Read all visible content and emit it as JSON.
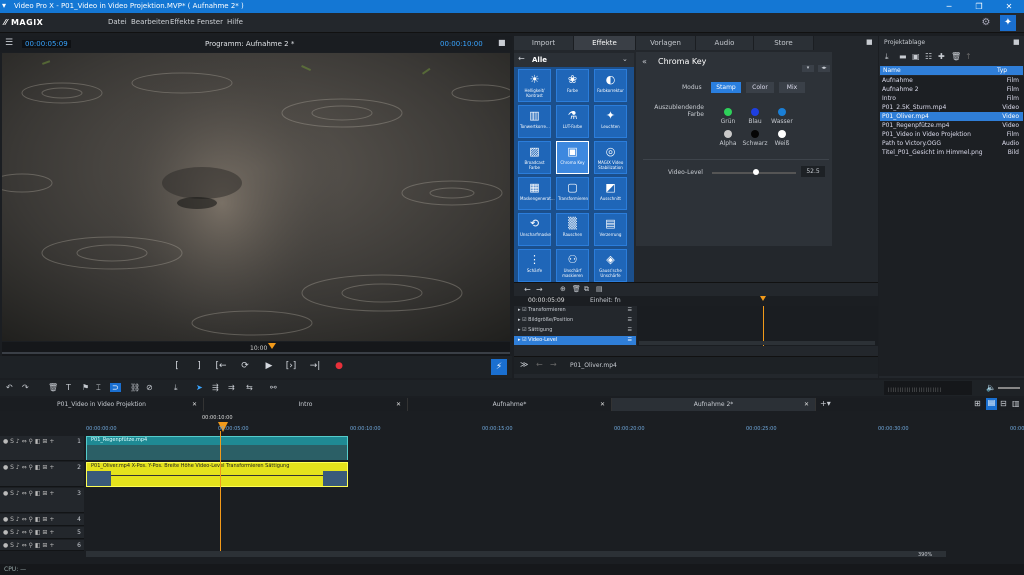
{
  "titlebar": {
    "title": "Video Pro X - P01_Video in Video Projektion.MVP* ( Aufnahme 2* )",
    "minimize": "─",
    "maximize": "❐",
    "close": "✕"
  },
  "menubar": {
    "logo": "MAGIX",
    "items": [
      "Datei",
      "Bearbeiten",
      "Effekte",
      "Fenster",
      "Hilfe"
    ]
  },
  "preview": {
    "timecode_left": "00:00:05:09",
    "title": "Programm: Aufnahme 2 *",
    "timecode_right": "00:00:10:00",
    "scrub_label": "10:00"
  },
  "transport": {
    "mark_in": "[",
    "mark_out": "]",
    "prev": "[←",
    "loop": "⟳",
    "play": "▶",
    "next_marker": "[›]",
    "to_end": "→|",
    "record": "●"
  },
  "tabs": [
    "Import",
    "Effekte",
    "Vorlagen",
    "Audio",
    "Store"
  ],
  "effects": {
    "header": "Alle",
    "items": [
      {
        "icon": "☀",
        "label": "Helligkeit/ Kontrast"
      },
      {
        "icon": "❀",
        "label": "Farbe"
      },
      {
        "icon": "◐",
        "label": "Farbkorrektur"
      },
      {
        "icon": "▥",
        "label": "Tonwertkorre..."
      },
      {
        "icon": "⚗",
        "label": "LUT-Farbe"
      },
      {
        "icon": "✦",
        "label": "Leuchten"
      },
      {
        "icon": "▨",
        "label": "Broadcast Farbe"
      },
      {
        "icon": "▣",
        "label": "Chroma Key"
      },
      {
        "icon": "◎",
        "label": "MAGIX Video Stabilization"
      },
      {
        "icon": "▦",
        "label": "Maskengenerat..."
      },
      {
        "icon": "▢",
        "label": "Transformieren"
      },
      {
        "icon": "◩",
        "label": "Ausschnitt"
      },
      {
        "icon": "⟲",
        "label": "Unscharfmaske"
      },
      {
        "icon": "▒",
        "label": "Rauschen"
      },
      {
        "icon": "▤",
        "label": "Verzerrung"
      },
      {
        "icon": "⋮",
        "label": "Schärfe"
      },
      {
        "icon": "⚇",
        "label": "Unschärf maskieren"
      },
      {
        "icon": "◈",
        "label": "Gauss'sche Unschärfe"
      }
    ]
  },
  "chroma": {
    "title": "Chroma Key",
    "modus_label": "Modus",
    "modes": [
      "Stamp",
      "Color",
      "Mix"
    ],
    "farbe_label": "Auszublendende Farbe",
    "colors": [
      {
        "name": "Grün",
        "hex": "#2ed15a"
      },
      {
        "name": "Blau",
        "hex": "#1e3fe0"
      },
      {
        "name": "Wasser",
        "hex": "#1a7fd6"
      },
      {
        "name": "Alpha",
        "hex": "#c9c9c9"
      },
      {
        "name": "Schwarz",
        "hex": "#050505"
      },
      {
        "name": "Weiß",
        "hex": "#ffffff"
      }
    ],
    "level_label": "Video-Level",
    "level_value": "52.5",
    "level_fraction": 0.525
  },
  "keyframes": {
    "timecode": "00:00:05:09",
    "unit": "Einheit: fn",
    "rows": [
      "Transformieren",
      "Bildgröße/Position",
      "Sättigung",
      "Video-Level"
    ],
    "footer_clip": "P01_Oliver.mp4"
  },
  "project": {
    "title": "Projektablage",
    "col_name": "Name",
    "col_type": "Typ",
    "rows": [
      {
        "name": "Aufnahme",
        "type": "Film"
      },
      {
        "name": "Aufnahme 2",
        "type": "Film"
      },
      {
        "name": "Intro",
        "type": "Film"
      },
      {
        "name": "P01_2.5K_Sturm.mp4",
        "type": "Video"
      },
      {
        "name": "P01_Oliver.mp4",
        "type": "Video"
      },
      {
        "name": "P01_Regenpfütze.mp4",
        "type": "Video"
      },
      {
        "name": "P01_Video in Video Projektion",
        "type": "Film"
      },
      {
        "name": "Path to Victory.OGG",
        "type": "Audio"
      },
      {
        "name": "Titel_P01_Gesicht im Himmel.png",
        "type": "Bild"
      }
    ]
  },
  "timeline_tabs": [
    {
      "label": "P01_Video in Video Projektion"
    },
    {
      "label": "Intro"
    },
    {
      "label": "Aufnahme*"
    },
    {
      "label": "Aufnahme 2*"
    }
  ],
  "timeline": {
    "cursor_tc": "00:00:10:00",
    "ruler": [
      "00:00:00:00",
      "00:00:05:00",
      "00:00:10:00",
      "00:00:15:00",
      "00:00:20:00",
      "00:00:25:00",
      "00:00:30:00",
      "00:00:35:00"
    ],
    "clip1": "P01_Regenpfütze.mp4",
    "clip2": "P01_Oliver.mp4 X-Pos. Y-Pos. Breite Höhe Video-Level Transformieren Sättigung",
    "track_numbers": [
      "1",
      "2",
      "3",
      "4",
      "5",
      "6"
    ],
    "track_letters": "S",
    "zoom": "390%"
  },
  "status": {
    "cpu": "CPU: —"
  }
}
